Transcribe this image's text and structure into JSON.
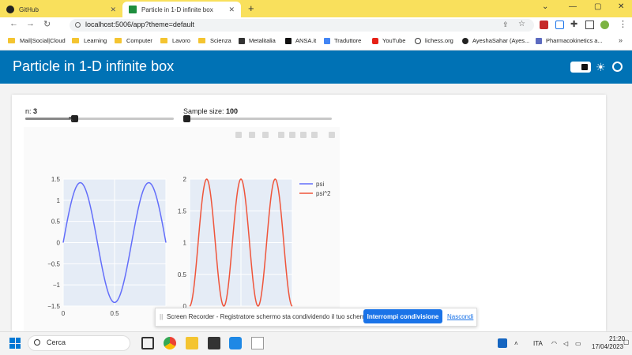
{
  "browser": {
    "tabs": [
      {
        "label": "GitHub",
        "active": false
      },
      {
        "label": "Particle in 1-D infinite box",
        "active": true
      }
    ],
    "new_tab": "+",
    "window_controls": {
      "minimize": "—",
      "maximize": "▢",
      "close": "✕"
    },
    "nav": {
      "back": "←",
      "forward": "→",
      "reload": "↻"
    },
    "url": "localhost:5006/app?theme=default",
    "bookmarks": [
      {
        "label": "Mail|Social|Cloud",
        "icon": "folder-icon"
      },
      {
        "label": "Learning",
        "icon": "folder-icon"
      },
      {
        "label": "Computer",
        "icon": "folder-icon"
      },
      {
        "label": "Lavoro",
        "icon": "folder-icon"
      },
      {
        "label": "Scienza",
        "icon": "folder-icon"
      },
      {
        "label": "Metalitalia",
        "icon": "metalitalia-icon"
      },
      {
        "label": "ANSA.it",
        "icon": "ansa-icon"
      },
      {
        "label": "Traduttore",
        "icon": "translate-icon"
      },
      {
        "label": "YouTube",
        "icon": "youtube-icon"
      },
      {
        "label": "lichess.org",
        "icon": "lichess-icon"
      },
      {
        "label": "AyeshaSahar (Ayes...",
        "icon": "github-icon"
      },
      {
        "label": "Pharmacokinetics a...",
        "icon": "pharma-icon"
      }
    ]
  },
  "app": {
    "title": "Particle in 1-D infinite box",
    "n_slider": {
      "label": "n:",
      "value": "3",
      "fraction": 0.2
    },
    "sample_slider": {
      "label": "Sample size:",
      "value": "100",
      "fraction": 0.0
    }
  },
  "chart_data": [
    {
      "type": "line",
      "series": [
        {
          "name": "psi",
          "color": "#636efa",
          "function": "sqrt(2)*sin(3*pi*x)"
        }
      ],
      "xlim": [
        0,
        1
      ],
      "ylim": [
        -1.5,
        1.5
      ],
      "xticks": [
        "0",
        "0.5"
      ],
      "yticks": [
        "1.5",
        "1",
        "0.5",
        "0",
        "−0.5",
        "−1",
        "−1.5"
      ]
    },
    {
      "type": "line",
      "series": [
        {
          "name": "psi^2",
          "color": "#ef553b",
          "function": "2*sin(3*pi*x)^2"
        }
      ],
      "xlim": [
        0,
        1
      ],
      "ylim": [
        0,
        2
      ],
      "yticks": [
        "2",
        "1.5",
        "1",
        "0.5",
        "0"
      ],
      "legend": [
        "psi",
        "psi^2"
      ],
      "legend_position": "right"
    }
  ],
  "recorder": {
    "grip": "||",
    "text": "Screen Recorder - Registratore schermo sta condividendo il tuo schermo.",
    "stop_button": "Interrompi condivisione",
    "hide_link": "Nascondi"
  },
  "taskbar": {
    "search_placeholder": "Cerca",
    "language": "ITA",
    "time": "21:20",
    "date": "17/04/2023"
  }
}
